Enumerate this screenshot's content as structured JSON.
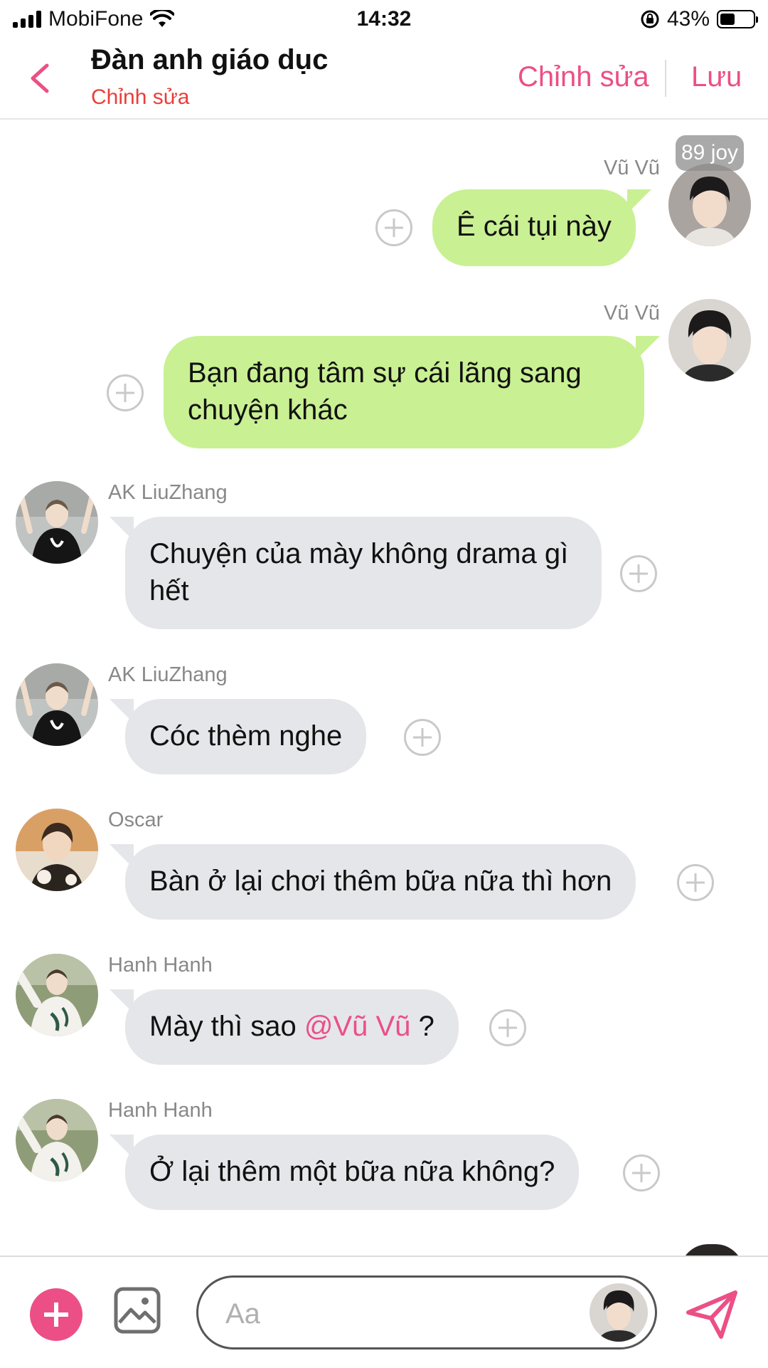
{
  "status_bar": {
    "carrier": "MobiFone",
    "time": "14:32",
    "battery_percent": "43%",
    "signal_bars": 4
  },
  "header": {
    "title": "Đàn anh giáo dục",
    "subtitle": "Chỉnh sửa",
    "edit_label": "Chỉnh sửa",
    "save_label": "Lưu"
  },
  "joy_badge": "89 joy",
  "messages": [
    {
      "sender": "Vũ Vũ",
      "side": "right",
      "text": "Ê cái tụi này"
    },
    {
      "sender": "Vũ Vũ",
      "side": "right",
      "text": "Bạn đang tâm sự cái lãng sang chuyện khác"
    },
    {
      "sender": "AK LiuZhang",
      "side": "left",
      "text": "Chuyện của mày không drama gì hết"
    },
    {
      "sender": "AK LiuZhang",
      "side": "left",
      "text": "Cóc thèm nghe"
    },
    {
      "sender": "Oscar",
      "side": "left",
      "text": "Bàn ở lại chơi thêm bữa nữa thì hơn"
    },
    {
      "sender": "Hanh Hanh",
      "side": "left",
      "text_before": "Mày thì sao ",
      "mention": "@Vũ Vũ",
      "text_after": " ?"
    },
    {
      "sender": "Hanh Hanh",
      "side": "left",
      "text": "Ở lại thêm một bữa nữa không?"
    }
  ],
  "composer": {
    "placeholder": "Aa"
  },
  "colors": {
    "accent": "#ec4f86",
    "my_bubble": "#c9f093",
    "other_bubble": "#e5e6e9",
    "subtitle_red": "#ea3e3a"
  },
  "icons": [
    "back-chevron-icon",
    "add-icon",
    "image-icon",
    "send-icon",
    "add-reaction-icon",
    "wifi-icon",
    "battery-icon",
    "orientation-lock-icon"
  ]
}
